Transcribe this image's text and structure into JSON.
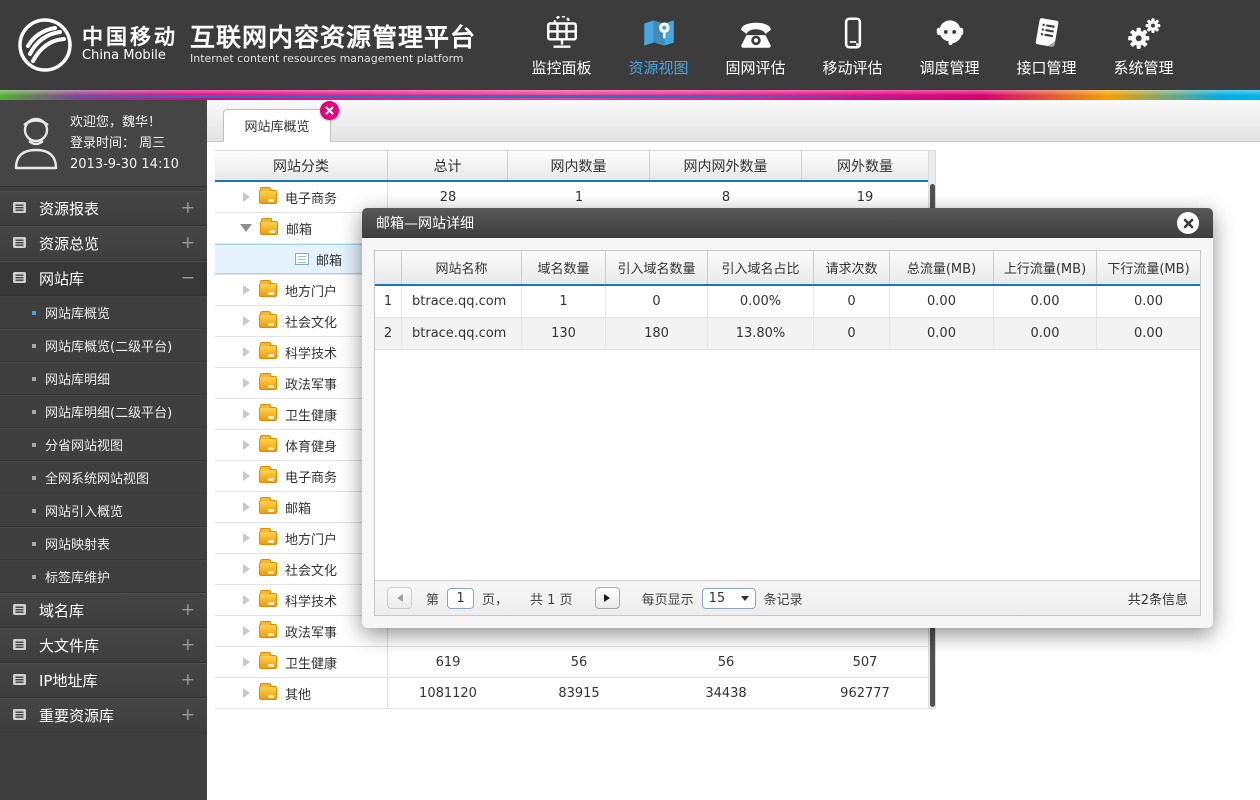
{
  "header": {
    "logo_cn": "中国移动",
    "logo_en": "China Mobile",
    "title": "互联网内容资源管理平台",
    "subtitle": "Internet content resources management platform",
    "accent_color": "#45a7e0",
    "nav": [
      {
        "label": "监控面板",
        "icon": "dashboard-icon",
        "active": false
      },
      {
        "label": "资源视图",
        "icon": "map-icon",
        "active": true
      },
      {
        "label": "固网评估",
        "icon": "phone-icon",
        "active": false
      },
      {
        "label": "移动评估",
        "icon": "mobile-icon",
        "active": false
      },
      {
        "label": "调度管理",
        "icon": "headset-icon",
        "active": false
      },
      {
        "label": "接口管理",
        "icon": "document-icon",
        "active": false
      },
      {
        "label": "系统管理",
        "icon": "gears-icon",
        "active": false
      }
    ]
  },
  "sidebar": {
    "user": {
      "avatar_icon": "user-avatar-icon",
      "welcome": "欢迎您，魏华！",
      "login_label": "登录时间： 周三",
      "login_time": "2013-9-30  14:10"
    },
    "groups": [
      {
        "label": "资源报表",
        "state": "+",
        "expanded": false,
        "children": []
      },
      {
        "label": "资源总览",
        "state": "+",
        "expanded": false,
        "children": []
      },
      {
        "label": "网站库",
        "state": "−",
        "expanded": true,
        "children": [
          {
            "label": "网站库概览",
            "active": true
          },
          {
            "label": "网站库概览(二级平台)",
            "active": false
          },
          {
            "label": "网站库明细",
            "active": false
          },
          {
            "label": "网站库明细(二级平台)",
            "active": false
          },
          {
            "label": "分省网站视图",
            "active": false
          },
          {
            "label": "全网系统网站视图",
            "active": false
          },
          {
            "label": "网站引入概览",
            "active": false
          },
          {
            "label": "网站映射表",
            "active": false
          },
          {
            "label": "标签库维护",
            "active": false
          }
        ]
      },
      {
        "label": "域名库",
        "state": "+",
        "expanded": false,
        "children": []
      },
      {
        "label": "大文件库",
        "state": "+",
        "expanded": false,
        "children": []
      },
      {
        "label": "IP地址库",
        "state": "+",
        "expanded": false,
        "children": []
      },
      {
        "label": "重要资源库",
        "state": "+",
        "expanded": false,
        "children": []
      }
    ]
  },
  "tab": {
    "label": "网站库概览",
    "close_icon": "close-icon",
    "close_color": "#e6007e"
  },
  "main_table": {
    "columns": [
      "网站分类",
      "总计",
      "网内数量",
      "网内网外数量",
      "网外数量"
    ],
    "rows": [
      {
        "label": "电子商务",
        "type": "folder",
        "values": [
          "28",
          "1",
          "8",
          "19"
        ]
      },
      {
        "label": "邮箱",
        "type": "folder-expanded",
        "values": [
          "",
          "",
          "",
          ""
        ]
      },
      {
        "label": "邮箱",
        "type": "leaf-selected",
        "values": [
          "",
          "",
          "",
          ""
        ]
      },
      {
        "label": "地方门户",
        "type": "folder",
        "values": [
          "",
          "",
          "",
          ""
        ]
      },
      {
        "label": "社会文化",
        "type": "folder",
        "values": [
          "",
          "",
          "",
          ""
        ]
      },
      {
        "label": "科学技术",
        "type": "folder",
        "values": [
          "",
          "",
          "",
          ""
        ]
      },
      {
        "label": "政法军事",
        "type": "folder",
        "values": [
          "",
          "",
          "",
          ""
        ]
      },
      {
        "label": "卫生健康",
        "type": "folder",
        "values": [
          "",
          "",
          "",
          ""
        ]
      },
      {
        "label": "体育健身",
        "type": "folder",
        "values": [
          "",
          "",
          "",
          ""
        ]
      },
      {
        "label": "电子商务",
        "type": "folder",
        "values": [
          "",
          "",
          "",
          ""
        ]
      },
      {
        "label": "邮箱",
        "type": "folder",
        "values": [
          "",
          "",
          "",
          ""
        ]
      },
      {
        "label": "地方门户",
        "type": "folder",
        "values": [
          "",
          "",
          "",
          ""
        ]
      },
      {
        "label": "社会文化",
        "type": "folder",
        "values": [
          "",
          "",
          "",
          ""
        ]
      },
      {
        "label": "科学技术",
        "type": "folder",
        "values": [
          "",
          "",
          "",
          ""
        ]
      },
      {
        "label": "政法军事",
        "type": "folder",
        "values": [
          "",
          "",
          "",
          ""
        ]
      },
      {
        "label": "卫生健康",
        "type": "folder",
        "values": [
          "619",
          "56",
          "56",
          "507"
        ]
      },
      {
        "label": "其他",
        "type": "folder",
        "values": [
          "1081120",
          "83915",
          "34438",
          "962777"
        ]
      }
    ]
  },
  "modal": {
    "title": "邮箱—网站详细",
    "close_icon": "close-icon",
    "columns": [
      "",
      "网站名称",
      "域名数量",
      "引入域名数量",
      "引入域名占比",
      "请求次数",
      "总流量(MB)",
      "上行流量(MB)",
      "下行流量(MB)"
    ],
    "rows": [
      [
        "1",
        "btrace.qq.com",
        "1",
        "0",
        "0.00%",
        "0",
        "0.00",
        "0.00",
        "0.00"
      ],
      [
        "2",
        "btrace.qq.com",
        "130",
        "180",
        "13.80%",
        "0",
        "0.00",
        "0.00",
        "0.00"
      ]
    ],
    "pagination": {
      "page_prefix": "第",
      "page_value": "1",
      "page_suffix": "页，",
      "total_pages": "共 1 页",
      "per_page_label": "每页显示",
      "per_page_value": "15",
      "per_page_suffix": "条记录",
      "total_info": "共2条信息"
    }
  }
}
